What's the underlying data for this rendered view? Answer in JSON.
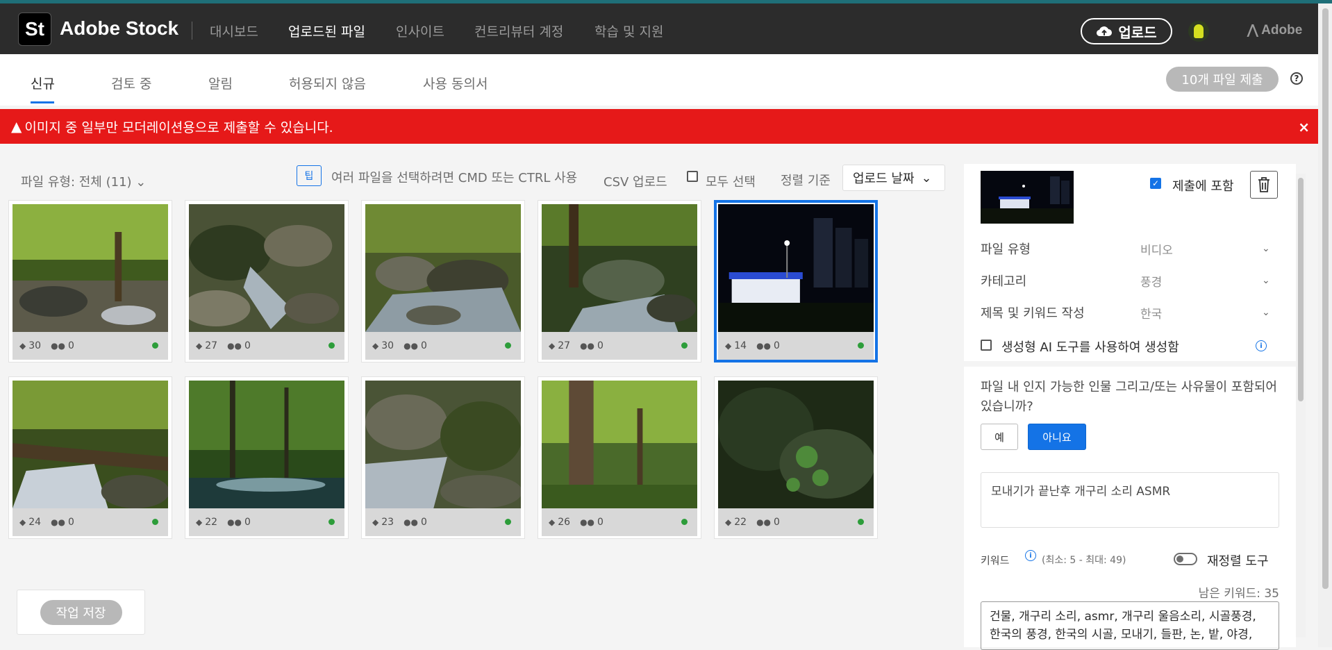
{
  "header": {
    "logo": "St",
    "brand": "Adobe Stock",
    "nav": [
      {
        "label": "대시보드",
        "active": false
      },
      {
        "label": "업로드된 파일",
        "active": true
      },
      {
        "label": "인사이트",
        "active": false
      },
      {
        "label": "컨트리뷰터 계정",
        "active": false
      },
      {
        "label": "학습 및 지원",
        "active": false
      }
    ],
    "upload_label": "업로드",
    "adobe_label": "Adobe"
  },
  "tabs": [
    {
      "label": "신규",
      "active": true
    },
    {
      "label": "검토 중",
      "active": false
    },
    {
      "label": "알림",
      "active": false
    },
    {
      "label": "허용되지 않음",
      "active": false
    },
    {
      "label": "사용 동의서",
      "active": false
    }
  ],
  "submit_label": "10개 파일 제출",
  "help_label": "?",
  "alert": {
    "message": "이미지 중 일부만 모더레이션용으로 제출할 수 있습니다.",
    "close": "×"
  },
  "toolbar": {
    "filetype": "파일 유형: 전체 (11)",
    "tip_badge": "팁",
    "tip_text": "여러 파일을 선택하려면 CMD 또는 CTRL 사용",
    "csv": "CSV 업로드",
    "select_all": "모두 선택",
    "sort_label": "정렬 기준",
    "sort_value": "업로드 날짜"
  },
  "files": [
    {
      "tags": "30",
      "people": "0",
      "scene": "forest1",
      "selected": false
    },
    {
      "tags": "27",
      "people": "0",
      "scene": "stream1",
      "selected": false
    },
    {
      "tags": "30",
      "people": "0",
      "scene": "rocks1",
      "selected": false
    },
    {
      "tags": "27",
      "people": "0",
      "scene": "forest2",
      "selected": false
    },
    {
      "tags": "14",
      "people": "0",
      "scene": "night",
      "selected": true
    },
    {
      "tags": "24",
      "people": "0",
      "scene": "waterfall",
      "selected": false
    },
    {
      "tags": "22",
      "people": "0",
      "scene": "green",
      "selected": false
    },
    {
      "tags": "23",
      "people": "0",
      "scene": "rocks2",
      "selected": false
    },
    {
      "tags": "26",
      "people": "0",
      "scene": "trunk",
      "selected": false
    },
    {
      "tags": "22",
      "people": "0",
      "scene": "dark",
      "selected": false
    }
  ],
  "save_label": "작업 저장",
  "panel": {
    "include_label": "제출에 포함",
    "filetype_label": "파일 유형",
    "filetype_value": "비디오",
    "category_label": "카테고리",
    "category_value": "풍경",
    "lang_label": "제목 및 키워드 작성",
    "lang_value": "한국",
    "ai_label": "생성형 AI 도구를 사용하여 생성함",
    "question": "파일 내 인지 가능한 인물 그리고/또는 사유물이 포함되어 있습니까?",
    "yes": "예",
    "no": "아니요",
    "title": "모내기가 끝난후 개구리 소리 ASMR",
    "kw_label": "키워드",
    "kw_range": "(최소: 5 - 최대: 49)",
    "reorder_label": "재정렬 도구",
    "remaining": "남은 키워드: 35",
    "keywords": "건물, 개구리 소리, asmr, 개구리 울음소리, 시골풍경, 한국의 풍경, 한국의 시골, 모내기, 들판, 논, 밭, 야경,"
  },
  "colors": {
    "accent": "#1473e6",
    "alert": "#e61919",
    "topbar": "#2c2c2c",
    "status_ok": "#2d9d3a"
  }
}
